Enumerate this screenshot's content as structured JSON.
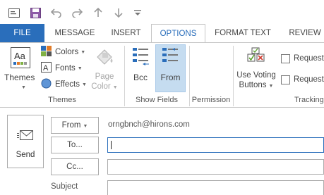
{
  "qat": {
    "icons": [
      "mail-icon",
      "save-icon",
      "undo-icon",
      "redo-icon",
      "up-arrow-icon",
      "down-arrow-icon",
      "customize-icon"
    ]
  },
  "tabs": {
    "file": "FILE",
    "message": "MESSAGE",
    "insert": "INSERT",
    "options": "OPTIONS",
    "format_text": "FORMAT TEXT",
    "review": "REVIEW"
  },
  "ribbon": {
    "themes_group": {
      "themes_label": "Themes",
      "colors_label": "Colors",
      "fonts_label": "Fonts",
      "effects_label": "Effects",
      "page_color_line1": "Page",
      "page_color_line2": "Color",
      "group_label": "Themes"
    },
    "show_fields_group": {
      "bcc_label": "Bcc",
      "from_label": "From",
      "group_label": "Show Fields"
    },
    "permission_group": {
      "group_label": "Permission"
    },
    "tracking_group": {
      "voting_line1": "Use Voting",
      "voting_line2": "Buttons",
      "request1": "Request",
      "request2": "Request",
      "group_label": "Tracking"
    }
  },
  "compose": {
    "send_label": "Send",
    "from_button": "From",
    "from_value": "orngbnch@hirons.com",
    "to_button": "To...",
    "cc_button": "Cc...",
    "subject_label": "Subject"
  },
  "colors": {
    "accent": "#2a6ebb",
    "selected_bg": "#c5dcf0"
  }
}
